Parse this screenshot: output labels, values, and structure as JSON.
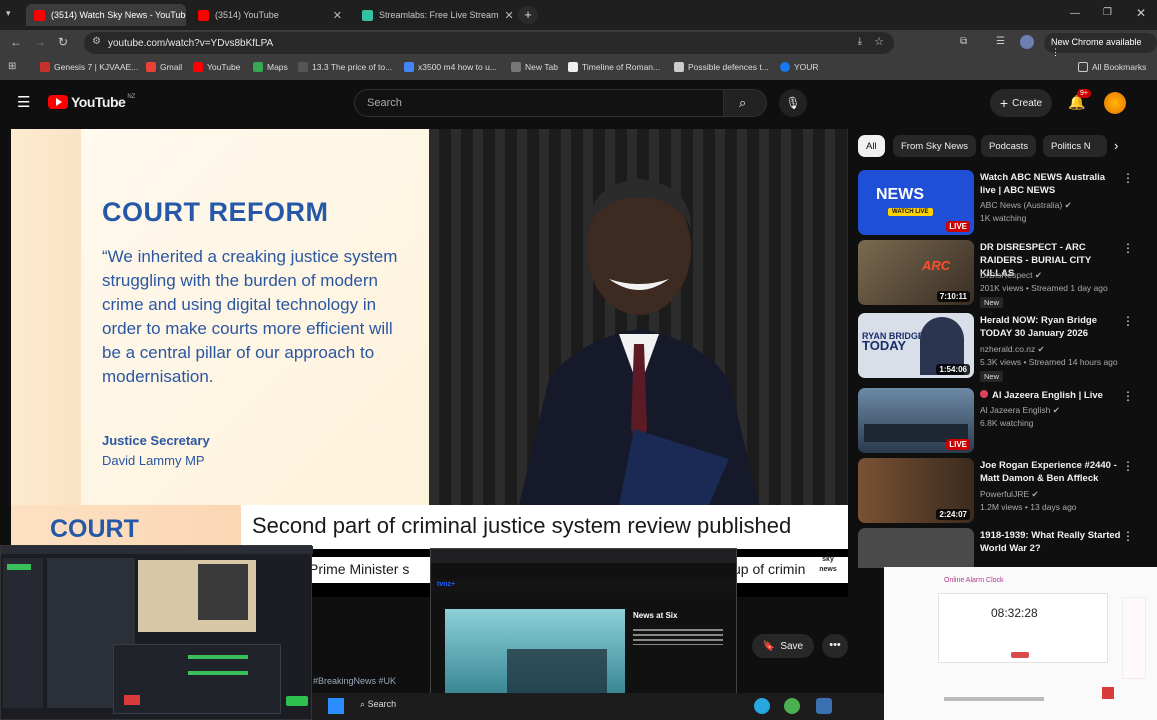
{
  "browser": {
    "tabs": [
      {
        "title": "(3514) Watch Sky News - YouTube",
        "favicon_color": "#ff0000"
      },
      {
        "title": "(3514) YouTube",
        "favicon_color": "#ff0000"
      },
      {
        "title": "Streamlabs: Free Live Stream",
        "favicon_color": "#31c3a2"
      }
    ],
    "url": "youtube.com/watch?v=YDvs8bKfLPA",
    "update_label": "New Chrome available",
    "bookmarks": [
      {
        "label": "Genesis 7 | KJVAAE...",
        "color": "#c9302c"
      },
      {
        "label": "Gmail",
        "color": "#ea4335"
      },
      {
        "label": "YouTube",
        "color": "#ff0000"
      },
      {
        "label": "Maps",
        "color": "#34a853"
      },
      {
        "label": "13.3 The price of to...",
        "color": "#555555"
      },
      {
        "label": "x3500 m4 how to u...",
        "color": "#4285f4"
      },
      {
        "label": "New Tab",
        "color": "#777777"
      },
      {
        "label": "Timeline of Roman...",
        "color": "#eeeeee"
      },
      {
        "label": "Possible defences t...",
        "color": "#cccccc"
      },
      {
        "label": "YOUR",
        "color": "#1877f2"
      }
    ],
    "all_bookmarks_label": "All Bookmarks"
  },
  "youtube": {
    "logo_text": "YouTube",
    "logo_region": "NZ",
    "search_placeholder": "Search",
    "create_label": "Create",
    "notif_count": "9+",
    "accent": "#ff0000"
  },
  "video": {
    "card_heading": "COURT REFORM",
    "quote": "“We inherited a creaking justice system struggling with the burden of modern crime and using digital technology in order to make courts more efficient will be a central pillar of our approach to modernisation.",
    "speaker_title": "Justice Secretary",
    "speaker_name": "David Lammy MP",
    "lower_label": "COURT REFORM",
    "headline": "Second part of criminal justice system review published",
    "ticker": "Prime Minister s",
    "ticker_tail": "up of crimin",
    "hashtags": "#BreakingNews #UK",
    "save_label": "Save"
  },
  "chips": [
    "All",
    "From Sky News",
    "Podcasts",
    "Politics N"
  ],
  "recommendations": [
    {
      "title": "Watch ABC NEWS Australia live | ABC NEWS",
      "channel": "ABC News (Australia)",
      "meta": "1K watching",
      "badge": "LIVE",
      "thumb_color": "#1f4fd6"
    },
    {
      "title": "DR DISRESPECT - ARC RAIDERS - BURIAL CITY KILLAS",
      "channel": "DrDisRespect",
      "meta": "201K views • Streamed 1 day ago",
      "badge": "7:10:11",
      "new": "New",
      "thumb_color": "#5b4b3a"
    },
    {
      "title": "Herald NOW: Ryan Bridge TODAY 30 January 2026",
      "channel": "nzherald.co.nz",
      "meta": "5.3K views • Streamed 14 hours ago",
      "badge": "1:54:06",
      "new": "New",
      "thumb_color": "#cfd6e2"
    },
    {
      "title": "Al Jazeera English | Live",
      "channel": "Al Jazeera English",
      "meta": "6.8K watching",
      "badge": "LIVE",
      "thumb_color": "#3a5d7a"
    },
    {
      "title": "Joe Rogan Experience #2440 - Matt Damon & Ben Affleck",
      "channel": "PowerfulJRE",
      "meta": "1.2M views • 13 days ago",
      "badge": "2:24:07",
      "thumb_color": "#6b4a2e"
    },
    {
      "title": "1918-1939: What Really Started World War 2?",
      "channel": "",
      "meta": "",
      "badge": "",
      "thumb_color": "#444444"
    }
  ],
  "overlays": {
    "obs_news_title": "News at Six",
    "clock_title": "Online Alarm Clock",
    "clock_time": "08:32:28",
    "taskbar_search": "Search",
    "sky_logo": "sky news"
  }
}
